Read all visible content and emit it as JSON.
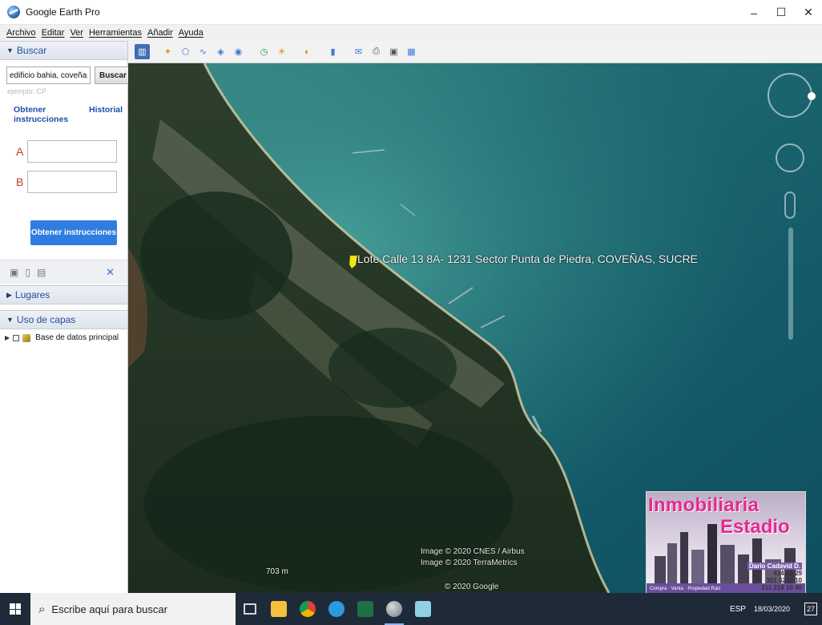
{
  "window": {
    "title": "Google Earth Pro",
    "minimize": "–",
    "maximize": "☐",
    "close": "✕"
  },
  "menu": [
    "Archivo",
    "Editar",
    "Ver",
    "Herramientas",
    "Añadir",
    "Ayuda"
  ],
  "search": {
    "header": "Buscar",
    "input_value": "edificio bahia, coveñas, sucre",
    "button": "Buscar",
    "hint": "ejemplo: CP",
    "directions_link": "Obtener instrucciones",
    "history_link": "Historial",
    "route_a": "A",
    "route_b": "B",
    "get_directions_button": "Obtener instrucciones"
  },
  "places": {
    "header": "Lugares"
  },
  "layers": {
    "header": "Uso de capas",
    "items": [
      "Base de datos principal"
    ]
  },
  "map": {
    "placemark_label": "Lote Calle 13 8A- 1231  Sector Punta de Piedra, COVEÑAS, SUCRE",
    "scale": "703 m",
    "copyright_lines": [
      "Image © 2020 CNES / Airbus",
      "Image © 2020 TerraMetrics"
    ],
    "google": "© 2020 Google"
  },
  "ad": {
    "line1": "Inmobiliaria",
    "line2": "Estadio",
    "contact_name": "Dario Cadavid D.",
    "phones": [
      "414 25 29",
      "301 5210 10",
      "311 218 10 40"
    ],
    "slogan": "Compra · Venta · Propiedad Raiz"
  },
  "taskbar": {
    "search_placeholder": "Escribe aquí para buscar",
    "lang": "ESP",
    "date": "18/03/2020",
    "notifications": "27"
  },
  "colors": {
    "accent": "#1e4fa6",
    "button_blue": "#2f7de0",
    "ad_pink": "#e6288f"
  }
}
